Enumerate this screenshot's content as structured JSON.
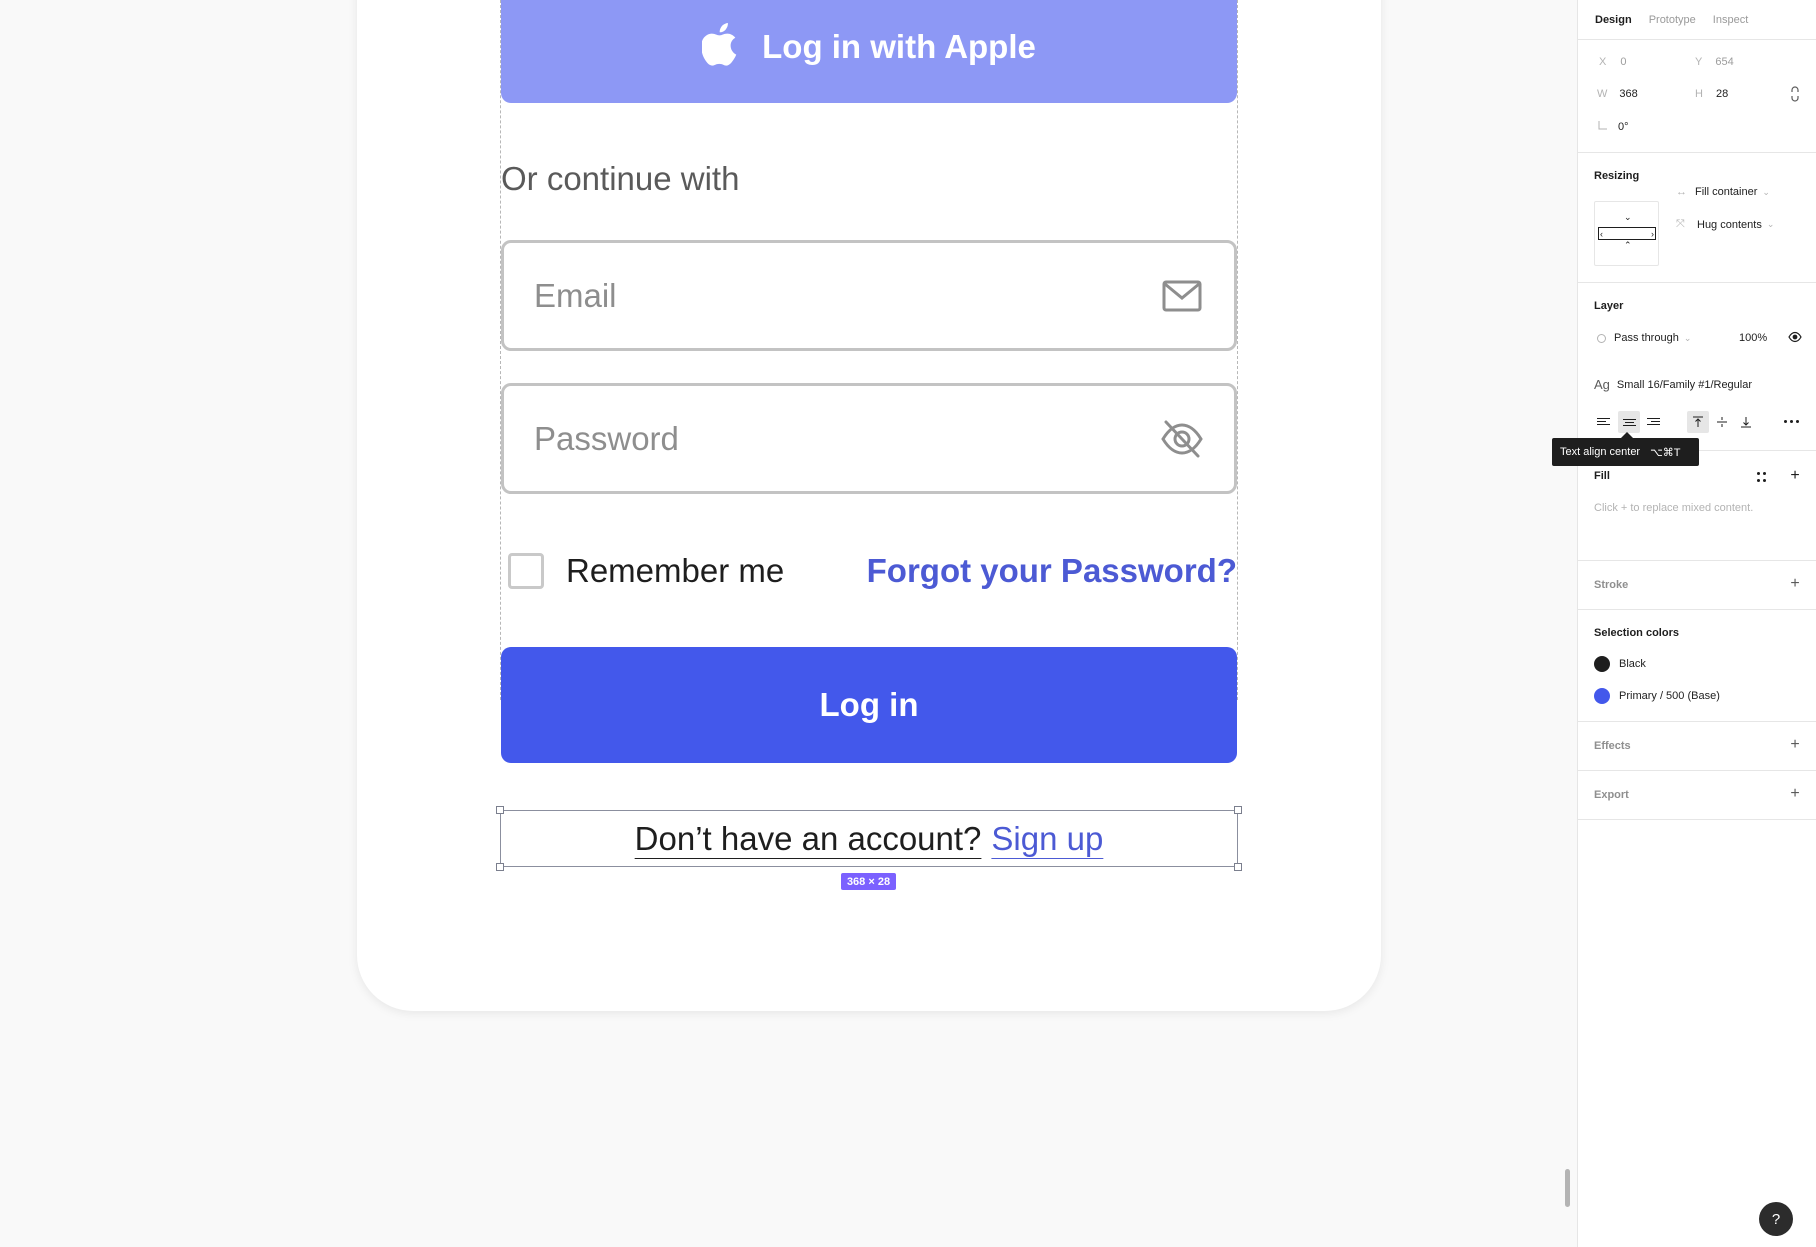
{
  "canvas": {
    "apple_button_label": "Log in with Apple",
    "or_text": "Or continue with",
    "email_placeholder": "Email",
    "password_placeholder": "Password",
    "remember_label": "Remember me",
    "forgot_link": "Forgot your Password?",
    "login_button_label": "Log in",
    "signup_question": "Don’t have an account?",
    "signup_link": "Sign up",
    "selection_size": "368 × 28"
  },
  "panel": {
    "tabs": [
      "Design",
      "Prototype",
      "Inspect"
    ],
    "active_tab": "Design",
    "position": {
      "x_label": "X",
      "x_value": "0",
      "y_label": "Y",
      "y_value": "654"
    },
    "size": {
      "w_label": "W",
      "w_value": "368",
      "h_label": "H",
      "h_value": "28"
    },
    "rotation": "0°",
    "resizing": {
      "title": "Resizing",
      "horizontal": "Fill container",
      "vertical": "Hug contents"
    },
    "layer": {
      "title": "Layer",
      "blend": "Pass through",
      "opacity": "100%"
    },
    "text_style": {
      "prefix": "Ag",
      "name": "Small 16/Family #1/Regular"
    },
    "tooltip": {
      "label": "Text align center",
      "shortcut": "⌥⌘T"
    },
    "fill": {
      "title": "Fill",
      "hint": "Click + to replace mixed content."
    },
    "stroke_title": "Stroke",
    "selection_colors": {
      "title": "Selection colors",
      "items": [
        {
          "name": "Black",
          "color": "#1e1e1e"
        },
        {
          "name": "Primary / 500 (Base)",
          "color": "#4358eb"
        }
      ]
    },
    "effects_title": "Effects",
    "export_title": "Export",
    "help": "?"
  },
  "colors": {
    "primary": "#4358eb",
    "primary_light": "#8d98f5",
    "link": "#4c5ad4",
    "selection": "#7b61ff"
  }
}
